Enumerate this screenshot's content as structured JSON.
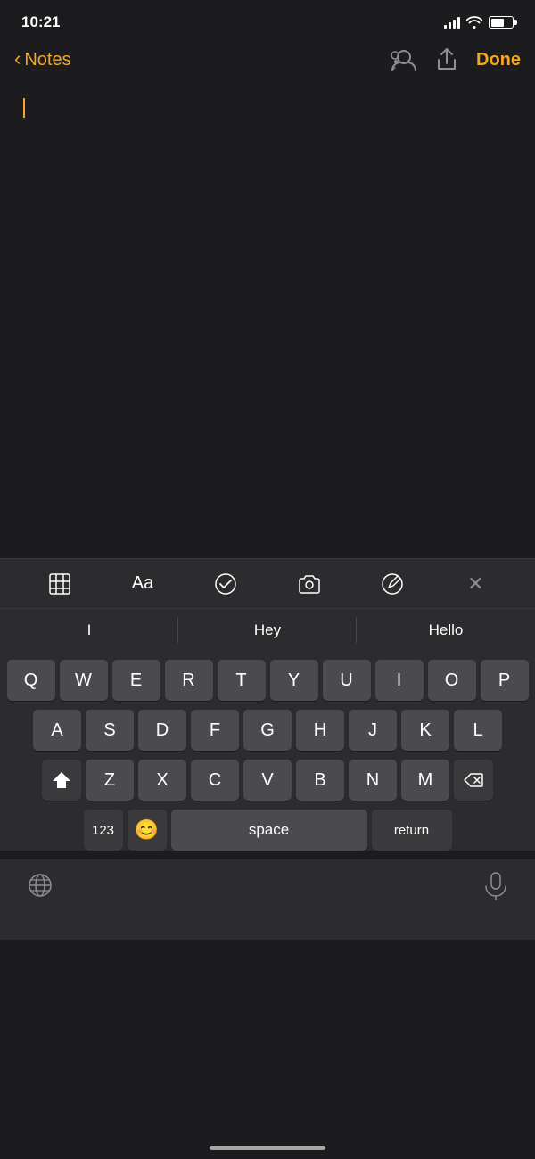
{
  "statusBar": {
    "time": "10:21",
    "batteryLevel": 65
  },
  "navbar": {
    "backLabel": "Notes",
    "doneLabel": "Done"
  },
  "toolbar": {
    "items": [
      "table",
      "format",
      "checklist",
      "camera",
      "pencil",
      "dismiss"
    ]
  },
  "predictive": {
    "suggestions": [
      "I",
      "Hey",
      "Hello"
    ]
  },
  "keyboard": {
    "rows": [
      [
        "Q",
        "W",
        "E",
        "R",
        "T",
        "Y",
        "U",
        "I",
        "O",
        "P"
      ],
      [
        "A",
        "S",
        "D",
        "F",
        "G",
        "H",
        "J",
        "K",
        "L"
      ],
      [
        "Z",
        "X",
        "C",
        "V",
        "B",
        "N",
        "M"
      ]
    ],
    "specialKeys": {
      "shift": "⬆",
      "delete": "⌫",
      "numbers": "123",
      "emoji": "😊",
      "space": "space",
      "return": "return"
    }
  },
  "bottomBar": {
    "globeIcon": "🌐",
    "micIcon": "mic"
  },
  "colors": {
    "accent": "#f5a623",
    "background": "#1c1c1e",
    "keyboardBg": "#2c2c2e",
    "keyBg": "#4a4a4f",
    "specialKeyBg": "#3a3a3c"
  }
}
